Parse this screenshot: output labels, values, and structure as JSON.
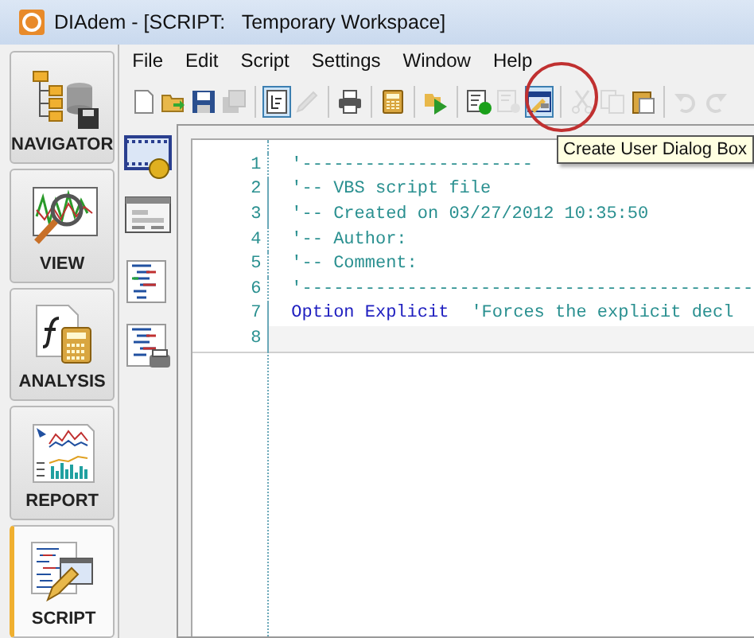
{
  "window": {
    "title": "DIAdem - [SCRIPT:   Temporary Workspace]"
  },
  "navigation": [
    {
      "label": "NAVIGATOR",
      "selected": false
    },
    {
      "label": "VIEW",
      "selected": false
    },
    {
      "label": "ANALYSIS",
      "selected": false
    },
    {
      "label": "REPORT",
      "selected": false
    },
    {
      "label": "SCRIPT",
      "selected": true
    }
  ],
  "menu": [
    "File",
    "Edit",
    "Script",
    "Settings",
    "Window",
    "Help"
  ],
  "toolbar": [
    {
      "kind": "button",
      "disabled": false,
      "selected": false
    },
    {
      "kind": "button",
      "disabled": false,
      "selected": false
    },
    {
      "kind": "button",
      "disabled": false,
      "selected": false
    },
    {
      "kind": "button",
      "disabled": true,
      "selected": false
    },
    {
      "kind": "separator"
    },
    {
      "kind": "button",
      "disabled": false,
      "selected": true
    },
    {
      "kind": "button",
      "disabled": true,
      "selected": false
    },
    {
      "kind": "separator"
    },
    {
      "kind": "button",
      "disabled": false,
      "selected": false
    },
    {
      "kind": "separator"
    },
    {
      "kind": "button",
      "disabled": false,
      "selected": false
    },
    {
      "kind": "separator"
    },
    {
      "kind": "button",
      "disabled": false,
      "selected": false
    },
    {
      "kind": "separator"
    },
    {
      "kind": "button",
      "disabled": false,
      "selected": false
    },
    {
      "kind": "button",
      "disabled": true,
      "selected": false
    },
    {
      "kind": "button",
      "disabled": false,
      "selected": true
    },
    {
      "kind": "separator"
    },
    {
      "kind": "button",
      "disabled": true,
      "selected": false
    },
    {
      "kind": "button",
      "disabled": true,
      "selected": false
    },
    {
      "kind": "button",
      "disabled": false,
      "selected": false
    },
    {
      "kind": "separator"
    },
    {
      "kind": "button",
      "disabled": true,
      "selected": false
    },
    {
      "kind": "button",
      "disabled": true,
      "selected": false
    }
  ],
  "tooltip": "Create User Dialog Box",
  "editor": {
    "lines": [
      {
        "number": "1",
        "current": false,
        "parts": [
          {
            "kind": "comment",
            "text": "'----------------------"
          }
        ]
      },
      {
        "number": "2",
        "current": false,
        "parts": [
          {
            "kind": "comment",
            "text": "'-- VBS script file"
          }
        ]
      },
      {
        "number": "3",
        "current": false,
        "parts": [
          {
            "kind": "comment",
            "text": "'-- Created on 03/27/2012 10:35:50"
          }
        ]
      },
      {
        "number": "4",
        "current": false,
        "parts": [
          {
            "kind": "comment",
            "text": "'-- Author:"
          }
        ]
      },
      {
        "number": "5",
        "current": false,
        "parts": [
          {
            "kind": "comment",
            "text": "'-- Comment:"
          }
        ]
      },
      {
        "number": "6",
        "current": false,
        "parts": [
          {
            "kind": "comment",
            "text": "'-------------------------------------------"
          }
        ]
      },
      {
        "number": "7",
        "current": false,
        "parts": [
          {
            "kind": "keyword",
            "text": "Option Explicit"
          },
          {
            "kind": "comment",
            "text": "'Forces the explicit decl"
          }
        ]
      },
      {
        "number": "8",
        "current": true
      }
    ]
  }
}
